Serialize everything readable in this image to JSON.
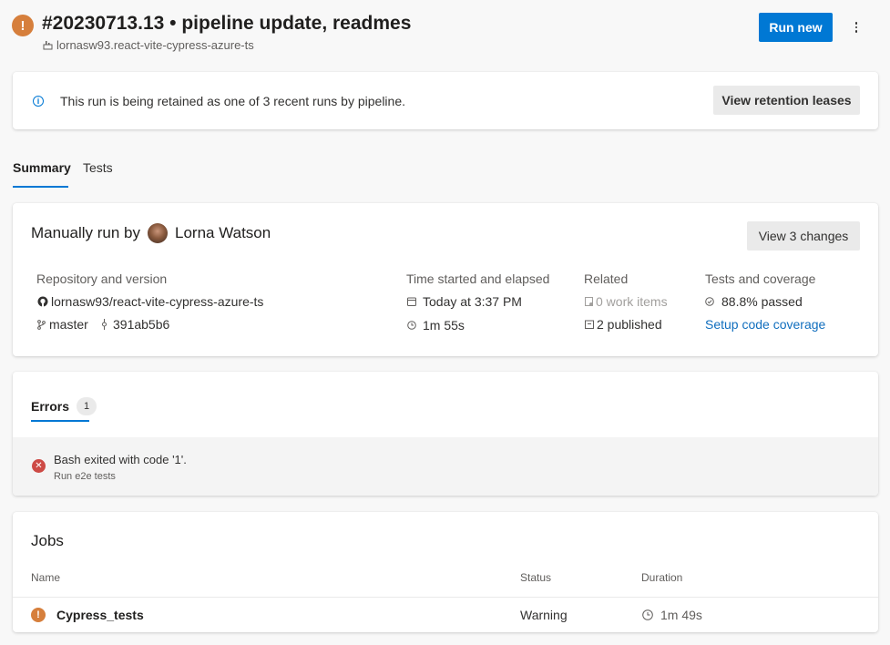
{
  "header": {
    "status_icon": "warning-icon",
    "title": "#20230713.13 • pipeline update, readmes",
    "repo": "lornasw93.react-vite-cypress-azure-ts",
    "run_new_label": "Run new",
    "more_icon": "more-vertical-icon"
  },
  "retention": {
    "message": "This run is being retained as one of 3 recent runs by pipeline.",
    "button_label": "View retention leases"
  },
  "tabs": [
    {
      "label": "Summary",
      "selected": true
    },
    {
      "label": "Tests",
      "selected": false
    }
  ],
  "summary": {
    "manually_run_by": "Manually run by",
    "user_name": "Lorna Watson",
    "view_changes_label": "View 3 changes",
    "repository": {
      "heading": "Repository and version",
      "repo": "lornasw93/react-vite-cypress-azure-ts",
      "branch": "master",
      "commit": "391ab5b6"
    },
    "time": {
      "heading": "Time started and elapsed",
      "started": "Today at 3:37 PM",
      "elapsed": "1m 55s"
    },
    "related": {
      "heading": "Related",
      "work_items": "0 work items",
      "published": "2 published"
    },
    "tests": {
      "heading": "Tests and coverage",
      "passed": "88.8% passed",
      "setup_link": "Setup code coverage"
    }
  },
  "errors": {
    "tab_label": "Errors",
    "count": "1",
    "items": [
      {
        "message": "Bash exited with code '1'.",
        "source": "Run e2e tests"
      }
    ]
  },
  "jobs": {
    "title": "Jobs",
    "columns": {
      "name": "Name",
      "status": "Status",
      "duration": "Duration"
    },
    "rows": [
      {
        "name": "Cypress_tests",
        "status": "Warning",
        "duration": "1m 49s"
      }
    ]
  },
  "colors": {
    "warning": "#d67f3c",
    "error": "#cd4a45",
    "primary": "#0078d4",
    "link": "#106ebe"
  }
}
